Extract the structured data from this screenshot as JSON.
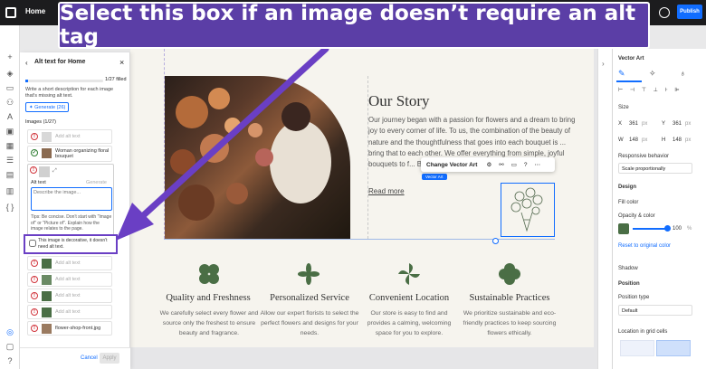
{
  "caption": "Select this box if an image doesn’t require an alt tag",
  "topbar": {
    "home": "Home",
    "publish": "Publish"
  },
  "panel": {
    "title": "Alt text for Home",
    "filled": "1/27 filled",
    "description": "Write a short description for each image that's missing alt text.",
    "generate_button": "Generate (26)",
    "images_heading": "Images (1/27)",
    "add_alt": "Add alt text",
    "item_woman": "Woman organizing floral bouquet",
    "alt_text_label": "Alt text",
    "generate_small": "Generate",
    "textarea_placeholder": "Describe the image...",
    "tips": "Tips: Be concise. Don't start with \"Image of\" or \"Picture of\". Explain how the image relates to the page.",
    "decorative_label": "This image is decorative, it doesn't need alt text.",
    "file_item": "flower-shop-front.jpg",
    "cancel": "Cancel",
    "apply": "Apply"
  },
  "canvas": {
    "story_title": "Our Story",
    "story_body": "Our journey began with a passion for flowers and a dream to bring joy to every corner of life. To us, the combination of the beauty of nature and the thoughtfulness that goes into each bouquet is ... bring that to each other. We offer everything from simple, joyful bouquets to f... Bliss add just a little bit of bliss to your story.",
    "read_more": "Read more",
    "toolbar_label": "Change Vector Art",
    "vector_tag": "Vector Art",
    "features": [
      {
        "title": "Quality and Freshness",
        "body": "We carefully select every flower and source only the freshest to ensure beauty and fragrance."
      },
      {
        "title": "Personalized Service",
        "body": "Allow our expert florists to select the perfect flowers and designs for your needs."
      },
      {
        "title": "Convenient Location",
        "body": "Our store is easy to find and provides a calming, welcoming space for you to explore."
      },
      {
        "title": "Sustainable Practices",
        "body": "We prioritize sustainable and eco-friendly practices to keep sourcing flowers ethically."
      }
    ]
  },
  "inspector": {
    "title": "Vector Art",
    "size": "Size",
    "x_label": "X",
    "x_val": "361",
    "y_label": "Y",
    "y_val": "361",
    "w_label": "W",
    "w_val": "148",
    "h_label": "H",
    "h_val": "148",
    "unit": "px",
    "responsive": "Responsive behavior",
    "responsive_val": "Scale proportionally",
    "design": "Design",
    "fill_color": "Fill color",
    "opacity_color": "Opacity & color",
    "opacity_val": "100",
    "opacity_unit": "%",
    "reset": "Reset to original color",
    "shadow": "Shadow",
    "position": "Position",
    "position_type": "Position type",
    "position_val": "Default",
    "grid_cells": "Location in grid cells",
    "fill_swatch": "#4a6e45"
  },
  "colors": {
    "accent": "#116dff",
    "caption_bg": "#5b3ea6",
    "highlight": "#6a3fc4",
    "green": "#4a6e45"
  }
}
